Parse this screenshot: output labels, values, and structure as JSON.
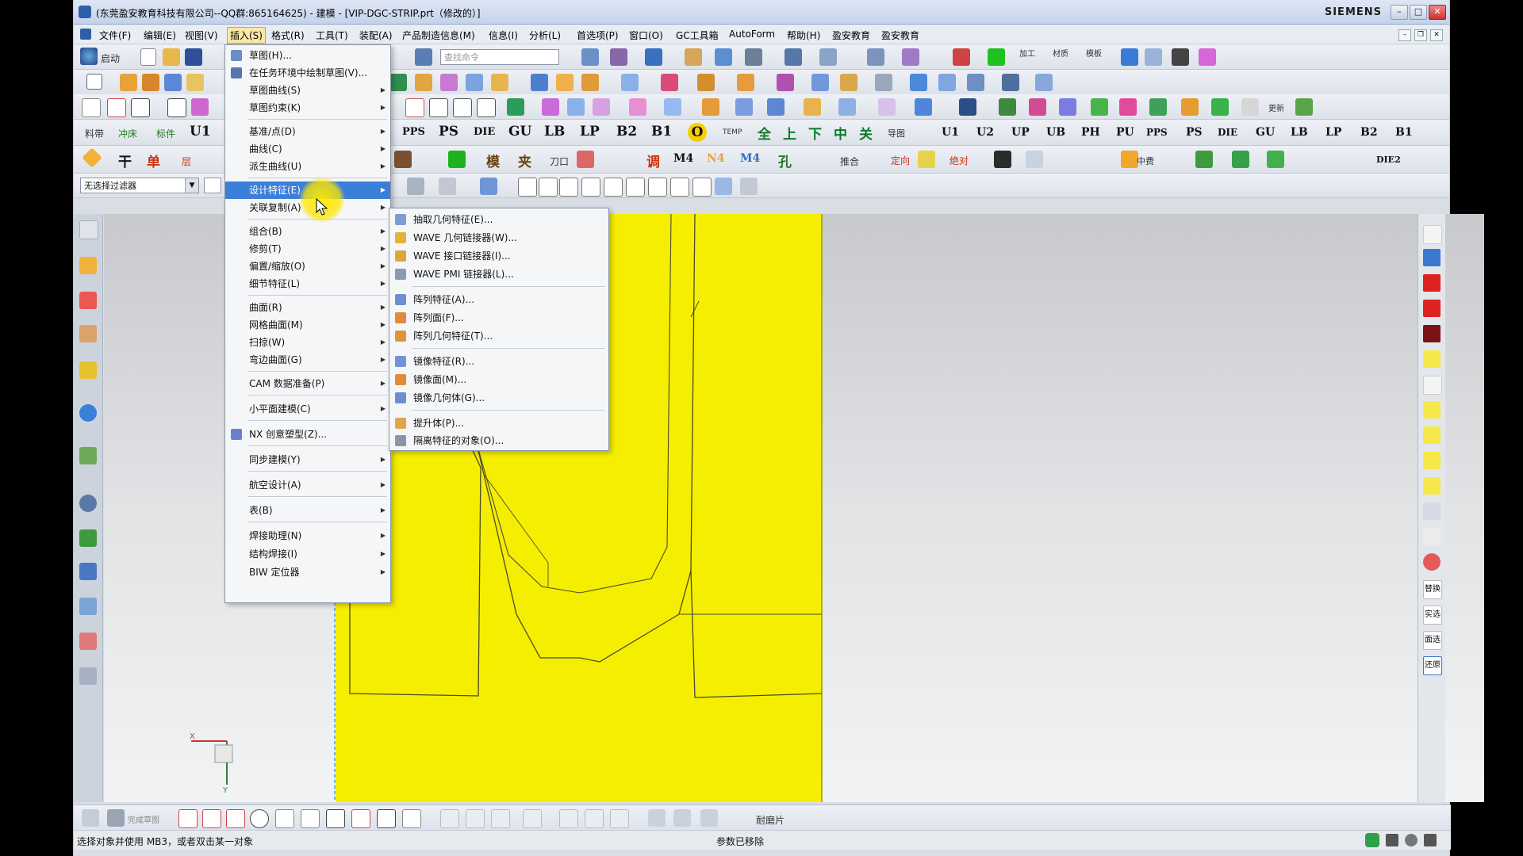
{
  "window": {
    "title": "(东莞盈安教育科技有限公司--QQ群:865164625) - 建模 - [VIP-DGC-STRIP.prt（修改的）]",
    "brand": "SIEMENS"
  },
  "menubar": {
    "items": [
      "文件(F)",
      "编辑(E)",
      "视图(V)",
      "插入(S)",
      "格式(R)",
      "工具(T)",
      "装配(A)",
      "产品制造信息(M)",
      "信息(I)",
      "分析(L)",
      "首选项(P)",
      "窗口(O)",
      "GC工具箱",
      "AutoForm",
      "帮助(H)",
      "盈安教育",
      "盈安教育"
    ],
    "active_index": 3
  },
  "toolbar": {
    "start_label": "启动",
    "search_placeholder": "查找命令",
    "filter_value": "无选择过滤器",
    "row4_texts": [
      "料带",
      "冲床",
      "标件",
      "U1",
      "PPS",
      "PS",
      "DIE",
      "GU",
      "LB",
      "LP",
      "B2",
      "B1",
      "O",
      "TEMP",
      "全",
      "上",
      "下",
      "中",
      "关",
      "导图",
      "U1",
      "U2",
      "UP",
      "UB",
      "PH",
      "PU",
      "PPS",
      "PS",
      "DIE",
      "GU",
      "LB",
      "LP",
      "B2",
      "B1"
    ],
    "row5_texts": [
      "干",
      "单",
      "层",
      "模",
      "夹",
      "刀口",
      "调",
      "M4",
      "N4",
      "M4",
      "孔",
      "推合",
      "定向",
      "绝对",
      "中费",
      "DIE2"
    ],
    "misc_small": [
      "加工",
      "材质",
      "模板",
      "更新"
    ]
  },
  "insert_menu": {
    "items": [
      {
        "label": "草图(H)...",
        "icon": true
      },
      {
        "label": "在任务环境中绘制草图(V)...",
        "icon": true
      },
      {
        "label": "草图曲线(S)",
        "submenu": true
      },
      {
        "label": "草图约束(K)",
        "submenu": true
      },
      {
        "label": "基准/点(D)",
        "submenu": true
      },
      {
        "label": "曲线(C)",
        "submenu": true
      },
      {
        "label": "派生曲线(U)",
        "submenu": true
      },
      {
        "label": "设计特征(E)",
        "submenu": true,
        "highlighted": true
      },
      {
        "label": "关联复制(A)",
        "submenu": true
      },
      {
        "label": "组合(B)",
        "submenu": true
      },
      {
        "label": "修剪(T)",
        "submenu": true
      },
      {
        "label": "偏置/缩放(O)",
        "submenu": true
      },
      {
        "label": "细节特征(L)",
        "submenu": true
      },
      {
        "label": "曲面(R)",
        "submenu": true
      },
      {
        "label": "网格曲面(M)",
        "submenu": true
      },
      {
        "label": "扫掠(W)",
        "submenu": true
      },
      {
        "label": "弯边曲面(G)",
        "submenu": true
      },
      {
        "label": "CAM 数据准备(P)",
        "submenu": true
      },
      {
        "label": "小平面建模(C)",
        "submenu": true
      },
      {
        "label": "NX 创意塑型(Z)...",
        "icon": true
      },
      {
        "label": "同步建模(Y)",
        "submenu": true
      },
      {
        "label": "航空设计(A)",
        "submenu": true
      },
      {
        "label": "表(B)",
        "submenu": true
      },
      {
        "label": "焊接助理(N)",
        "submenu": true
      },
      {
        "label": "结构焊接(I)",
        "submenu": true
      },
      {
        "label": "BIW 定位器",
        "submenu": true
      }
    ]
  },
  "assoc_copy_submenu": {
    "items": [
      "抽取几何特征(E)...",
      "WAVE 几何链接器(W)...",
      "WAVE 接口链接器(I)...",
      "WAVE PMI 链接器(L)...",
      "阵列特征(A)...",
      "阵列面(F)...",
      "阵列几何特征(T)...",
      "镜像特征(R)...",
      "镜像面(M)...",
      "镜像几何体(G)...",
      "提升体(P)...",
      "隔离特征的对象(O)..."
    ]
  },
  "bottom_toolbar": {
    "label1": "完成草图",
    "label2": "耐磨片"
  },
  "right_rail": {
    "labels": [
      "替换",
      "实选",
      "面选",
      "还原"
    ]
  },
  "status": {
    "left": "选择对象并使用 MB3，或者双击某一对象",
    "center": "参数已移除"
  },
  "colors": {
    "model": "#f5ee00",
    "highlight": "#3c7fd8",
    "menu_active": "#fbe8a6"
  }
}
